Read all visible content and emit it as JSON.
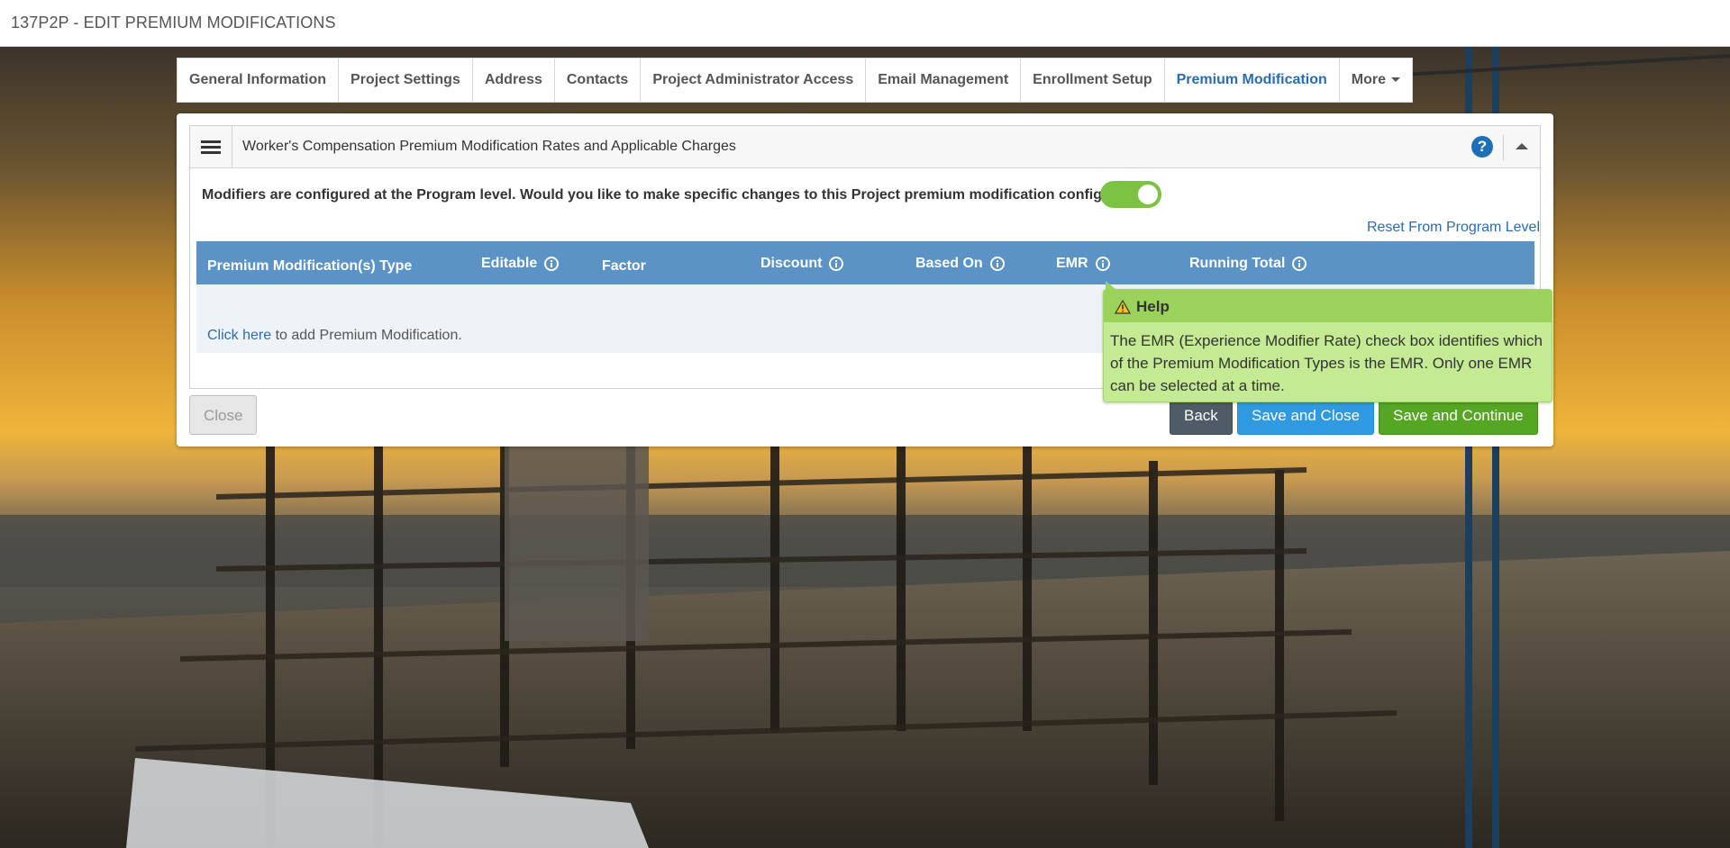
{
  "page": {
    "title": "137P2P - EDIT PREMIUM MODIFICATIONS"
  },
  "tabs": [
    {
      "label": "General Information",
      "active": false
    },
    {
      "label": "Project Settings",
      "active": false
    },
    {
      "label": "Address",
      "active": false
    },
    {
      "label": "Contacts",
      "active": false
    },
    {
      "label": "Project Administrator Access",
      "active": false
    },
    {
      "label": "Email Management",
      "active": false
    },
    {
      "label": "Enrollment Setup",
      "active": false
    },
    {
      "label": "Premium Modification",
      "active": true
    },
    {
      "label": "More",
      "active": false
    }
  ],
  "panel": {
    "title": "Worker's Compensation Premium Modification Rates and Applicable Charges",
    "help_icon": "?",
    "question": "Modifiers are configured at the Program level. Would you like to make specific changes to this Project premium modification configuration?",
    "toggle_on": true,
    "reset_link": "Reset From Program Level"
  },
  "table": {
    "columns": [
      {
        "label": "Premium Modification(s) Type",
        "info": false
      },
      {
        "label": "Editable",
        "info": true
      },
      {
        "label": "Factor",
        "info": false
      },
      {
        "label": "Discount",
        "info": true
      },
      {
        "label": "Based On",
        "info": true
      },
      {
        "label": "EMR",
        "info": true
      },
      {
        "label": "Running Total",
        "info": true
      }
    ],
    "empty_link": "Click here",
    "empty_text": " to add Premium Modification."
  },
  "buttons": {
    "close": "Close",
    "back": "Back",
    "save_close": "Save and Close",
    "save_continue": "Save and Continue"
  },
  "tooltip": {
    "title": "Help",
    "body": "The EMR (Experience Modifier Rate) check box identifies which of the Premium Modification Types is the EMR. Only one EMR can be selected at a time."
  },
  "colors": {
    "accent": "#2b6cb0",
    "table_header": "#5b93c7",
    "toggle": "#7cc243",
    "save_continue": "#55a622",
    "save_close": "#2f9ae0",
    "tooltip": "#c4ea93"
  }
}
